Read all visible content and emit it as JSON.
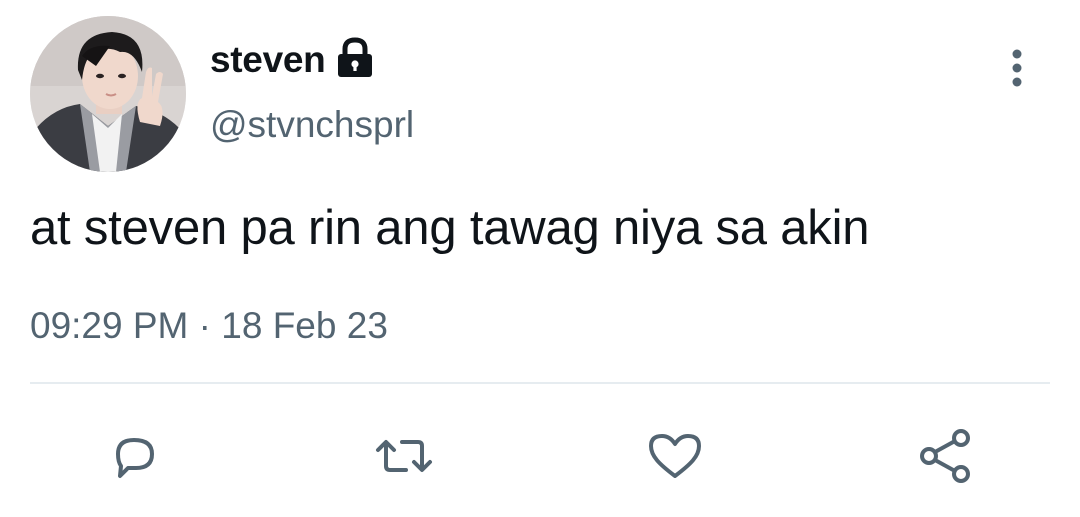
{
  "tweet": {
    "display_name": "steven",
    "handle": "@stvnchsprl",
    "text": "at steven pa rin ang tawag niya sa akin",
    "time": "09:29 PM",
    "separator": "·",
    "date": "18 Feb 23",
    "account_protected": true
  },
  "icons": {
    "lock": "lock-icon",
    "more": "more-vertical-icon",
    "reply": "reply-icon",
    "retweet": "retweet-icon",
    "like": "heart-icon",
    "share": "share-icon"
  },
  "colors": {
    "text_primary": "#0f1419",
    "text_secondary": "#536471",
    "icon": "#536471",
    "divider": "#e6ecf0",
    "background": "#ffffff"
  }
}
